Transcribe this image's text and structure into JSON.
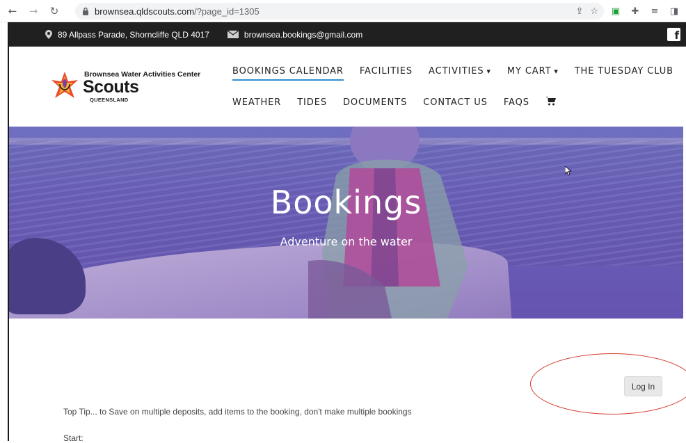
{
  "browser": {
    "url_host": "brownsea.qldscouts.com",
    "url_path": "/?page_id=1305"
  },
  "topbar": {
    "address": "89 Allpass Parade, Shorncliffe QLD 4017",
    "email": "brownsea.bookings@gmail.com",
    "facebook_label": "f"
  },
  "logo": {
    "org": "Brownsea Water Activities Center",
    "brand": "Scouts",
    "sub": "QUEENSLAND"
  },
  "menu": {
    "row1": [
      {
        "label": "BOOKINGS CALENDAR"
      },
      {
        "label": "FACILITIES"
      },
      {
        "label": "ACTIVITIES"
      },
      {
        "label": "MY CART"
      },
      {
        "label": "THE TUESDAY CLUB"
      }
    ],
    "row2": [
      {
        "label": "WEATHER"
      },
      {
        "label": "TIDES"
      },
      {
        "label": "DOCUMENTS"
      },
      {
        "label": "CONTACT US"
      },
      {
        "label": "FAQS"
      }
    ]
  },
  "hero": {
    "title": "Bookings",
    "subtitle": "Adventure on the water"
  },
  "content": {
    "login_label": "Log In",
    "tip": "Top Tip... to Save on multiple deposits, add items to the booking, don't make multiple bookings",
    "start_label": "Start:"
  },
  "colors": {
    "topbar_bg": "#202020",
    "menu_active_underline": "#2b8fd2",
    "hero_overlay": "#6a5fb8",
    "annotation_ring": "#d33a2c"
  }
}
